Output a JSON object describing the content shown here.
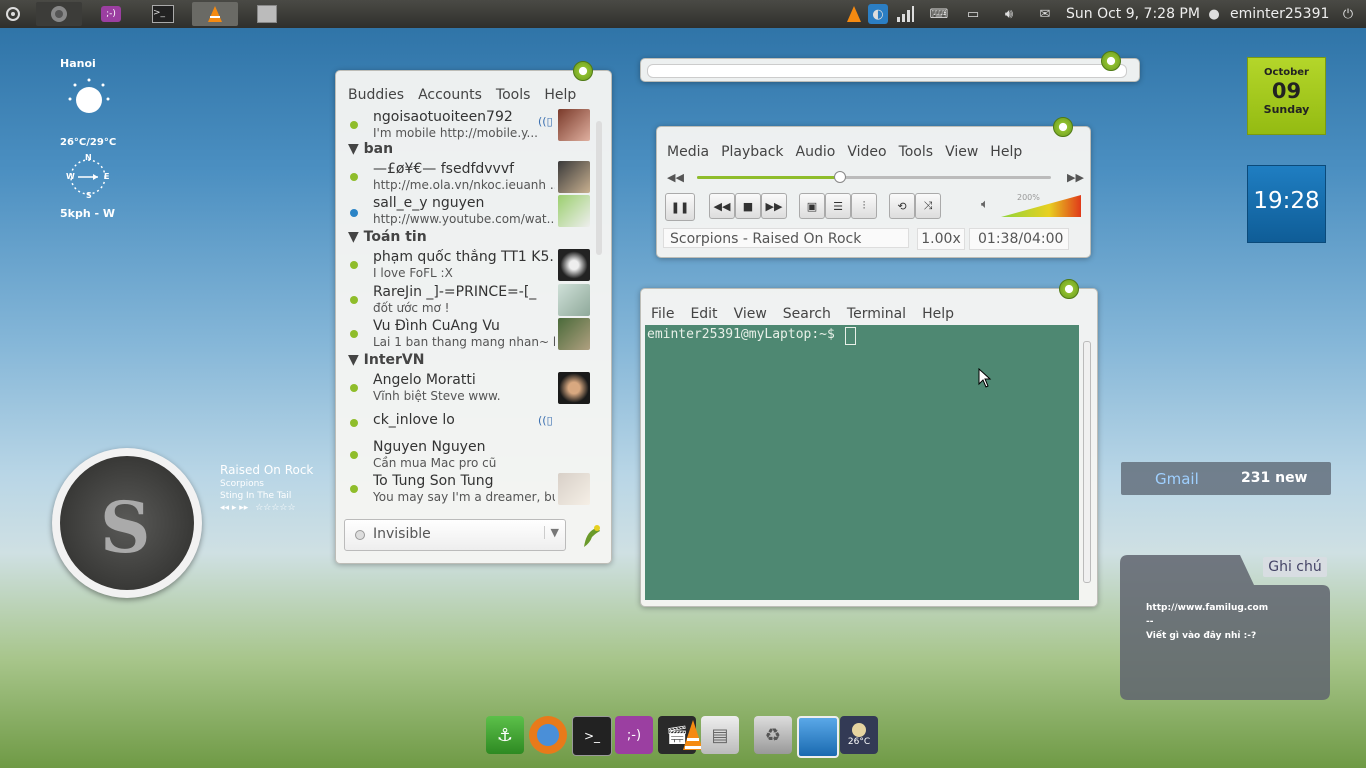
{
  "topbar": {
    "datetime": "Sun Oct  9,  7:28 PM",
    "username": "eminter25391"
  },
  "weather": {
    "city": "Hanoi",
    "temp": "26°C/29°C",
    "compass": {
      "n": "N",
      "s": "S",
      "e": "E",
      "w": "W"
    },
    "wind": "5kph - W"
  },
  "music": {
    "track": "Raised On Rock",
    "artist": "Scorpions",
    "album": "Sting In The Tail",
    "rating": "☆☆☆☆☆",
    "controls": "◂◂ ▸ ▸▸"
  },
  "pidgin": {
    "menu": [
      "Buddies",
      "Accounts",
      "Tools",
      "Help"
    ],
    "status": "Invisible",
    "groups": {
      "g1": "ban",
      "g2": "Toán tin",
      "g3": "InterVN"
    },
    "buddies": [
      {
        "name": "ngoisaotuoiteen792",
        "msg": "I'm mobile http://mobile.y..."
      },
      {
        "name": "—£ø¥€— fsedfdvvvf",
        "msg": "http://me.ola.vn/nkoc.ieuanh ..."
      },
      {
        "name": "sall_e_y nguyen",
        "msg": "http://www.youtube.com/wat..."
      },
      {
        "name": "phạm quốc thắng TT1 K5...",
        "msg": "I love FoFL :X"
      },
      {
        "name": "RareJin _]-=PRINCE=-[_",
        "msg": "đốt ước mơ !"
      },
      {
        "name": "Vu Đình CuAng Vu",
        "msg": "Lai 1 ban thang mang nhan~ hi..."
      },
      {
        "name": "Angelo Moratti",
        "msg": "Vĩnh biệt Steve www."
      },
      {
        "name": "ck_inlove lo",
        "msg": ""
      },
      {
        "name": "Nguyen Nguyen",
        "msg": "Cần mua Mac pro cũ"
      },
      {
        "name": "To Tung Son Tung",
        "msg": "You may say I'm a dreamer, bu..."
      }
    ]
  },
  "vlc": {
    "menu": [
      "Media",
      "Playback",
      "Audio",
      "Video",
      "Tools",
      "View",
      "Help"
    ],
    "progress": 0.4,
    "volume_label": "200%",
    "title": "Scorpions - Raised On Rock",
    "speed": "1.00x",
    "time": "01:38/04:00"
  },
  "terminal": {
    "menu": [
      "File",
      "Edit",
      "View",
      "Search",
      "Terminal",
      "Help"
    ],
    "prompt": "eminter25391@myLaptop:~$"
  },
  "calendar": {
    "month": "October",
    "day": "09",
    "weekday": "Sunday"
  },
  "clock_widget": {
    "time": "19:28"
  },
  "gmail": {
    "label": "Gmail",
    "count": "231 new"
  },
  "note": {
    "tab": "Ghi chú",
    "line1": "http://www.familug.com",
    "line2": "--",
    "line3": "Viết gì vào đây nhỉ :-?"
  },
  "dock": {
    "weather_temp": "26°C"
  },
  "colors": {
    "accent": "#8fbd2b",
    "terminal_bg": "#4e8872",
    "calendar": "#a6cc1e",
    "clock": "#1569a8"
  }
}
